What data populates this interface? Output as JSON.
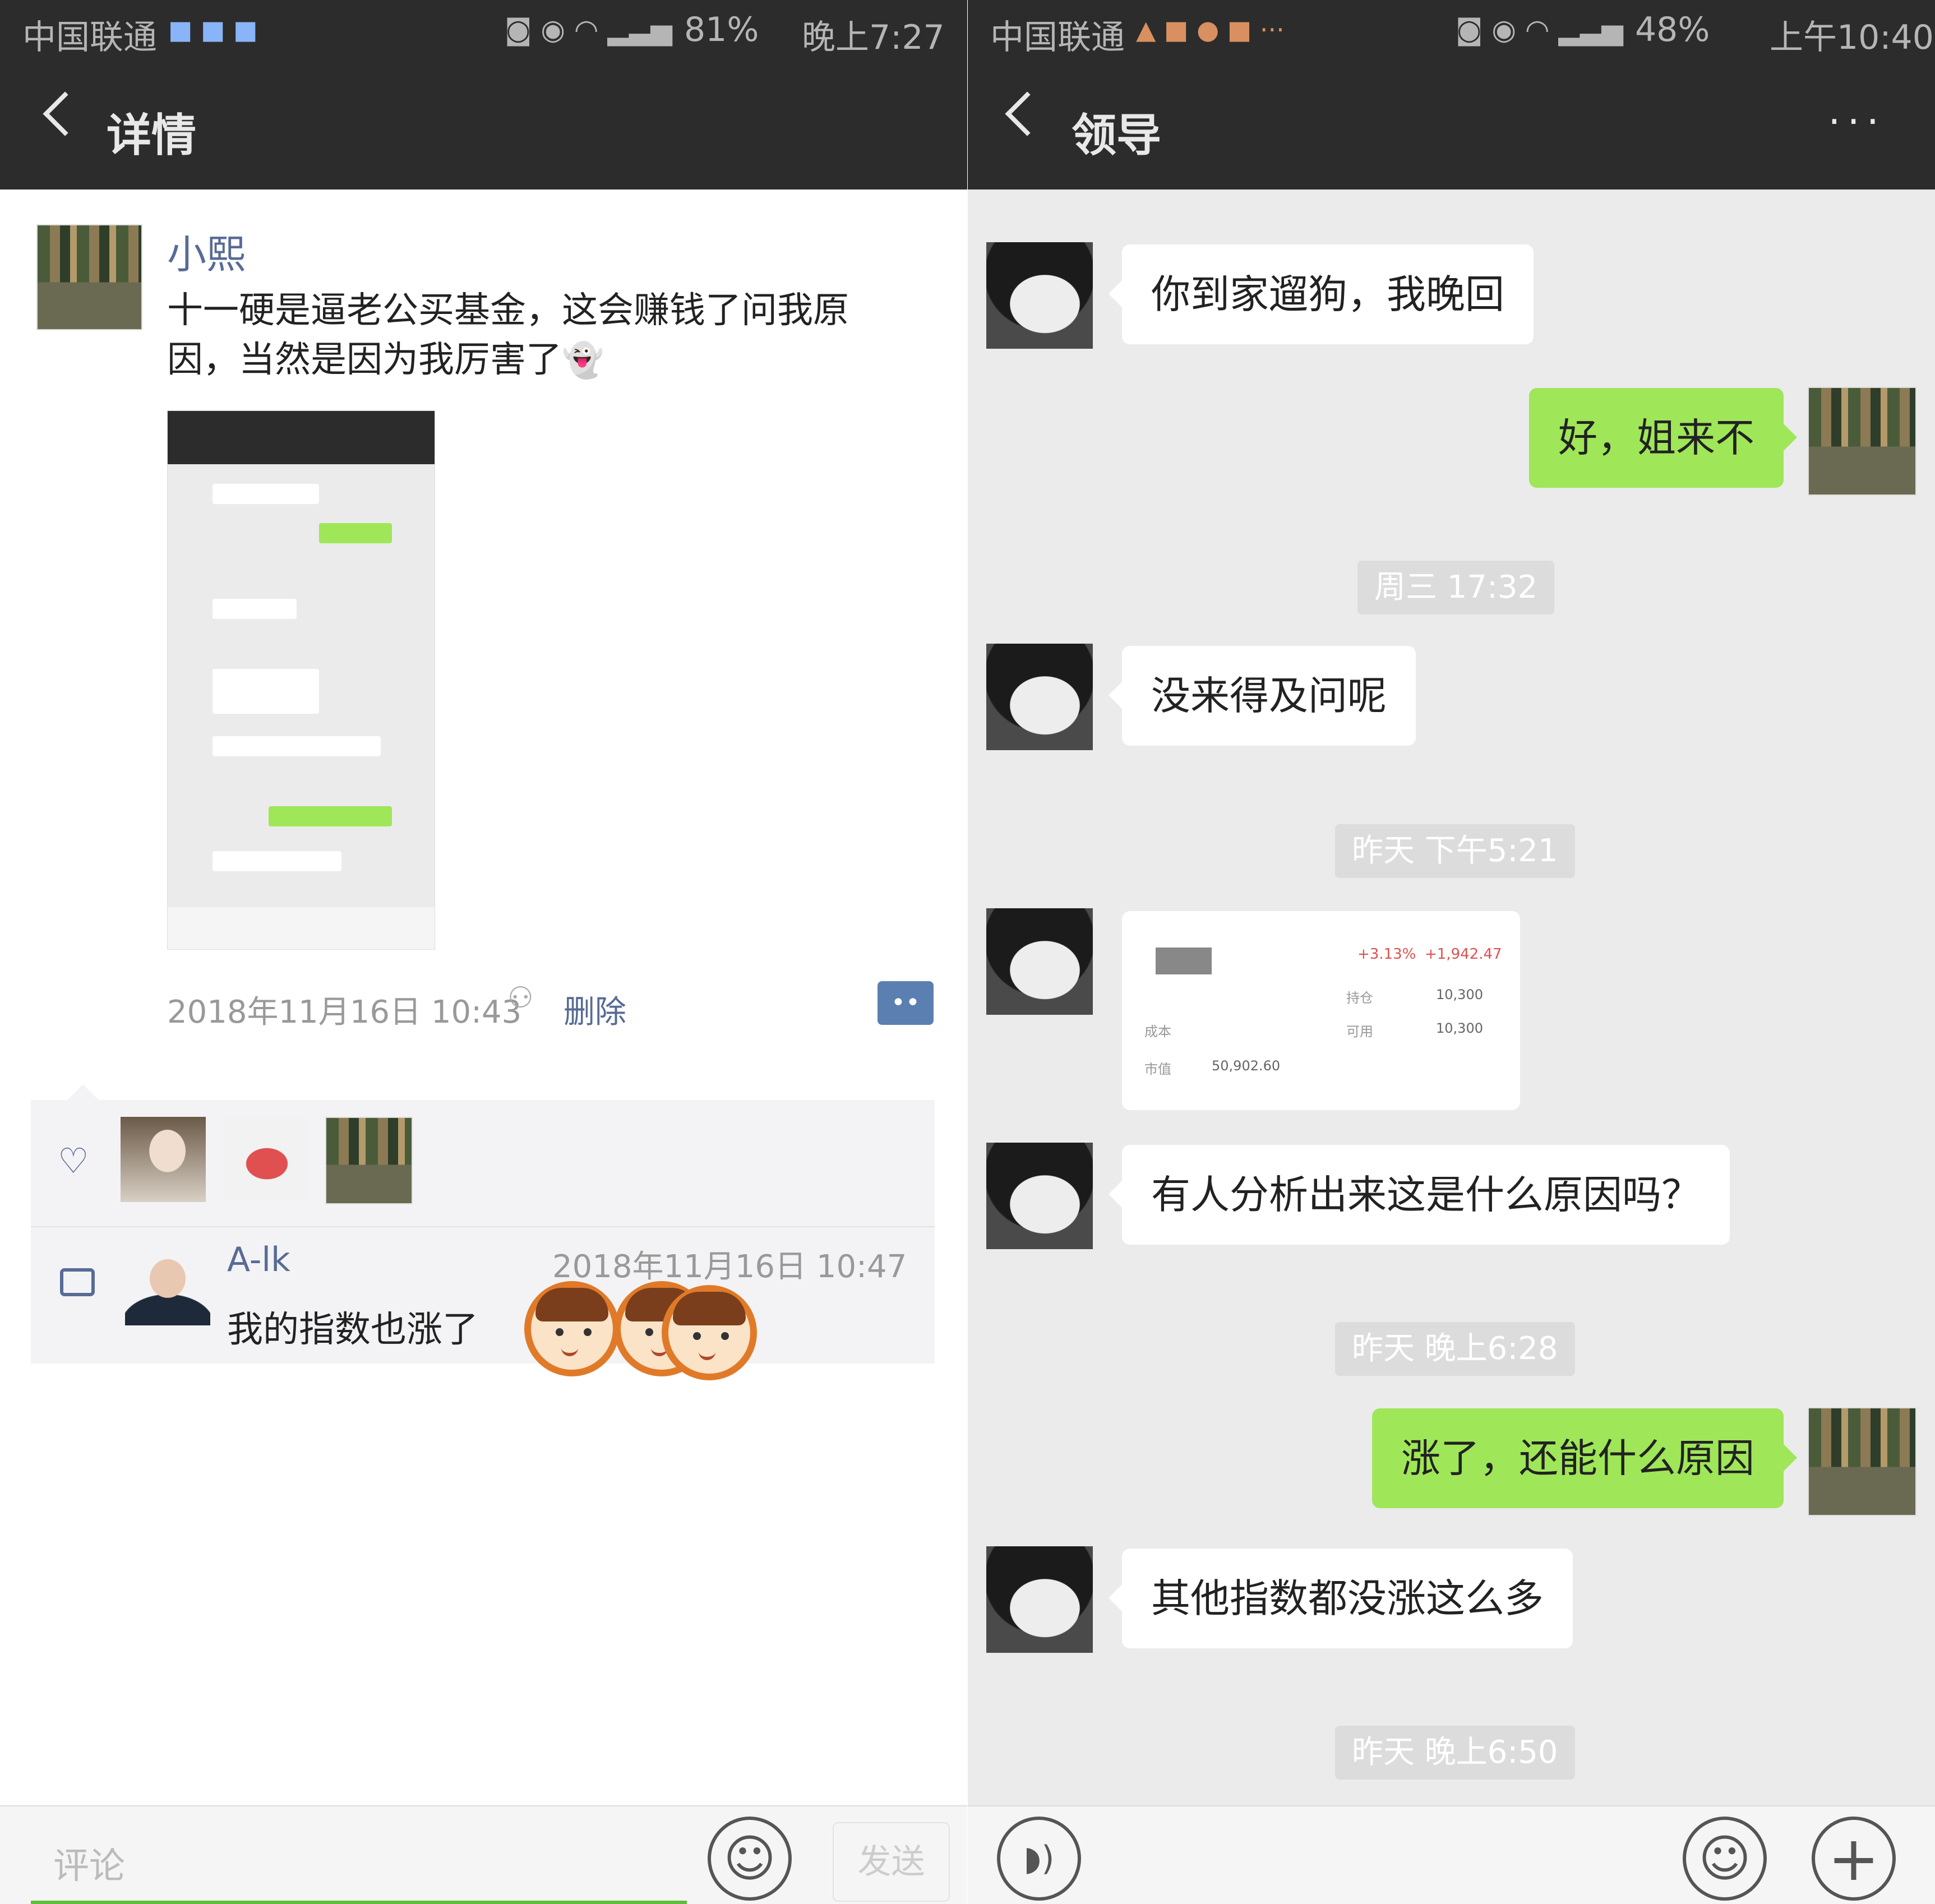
{
  "left": {
    "status": {
      "carrier": "中国联通",
      "signal": "81%",
      "time": "晚上7:27"
    },
    "nav": {
      "title": "详情"
    },
    "moment": {
      "author": "小熙",
      "text": "十一硬是逼老公买基金，这会赚钱了问我原因，当然是因为我厉害了",
      "timestamp": "2018年11月16日 10:43",
      "delete_label": "删除"
    },
    "comment": {
      "author": "A-lk",
      "time": "2018年11月16日 10:47",
      "text": "我的指数也涨了"
    },
    "input": {
      "placeholder": "评论",
      "send_label": "发送"
    }
  },
  "right": {
    "status": {
      "carrier": "中国联通",
      "signal": "48%",
      "time": "上午10:40"
    },
    "nav": {
      "title": "领导",
      "more": "···"
    },
    "messages": [
      {
        "from": "them",
        "text": "你到家遛狗，我晚回"
      },
      {
        "from": "me",
        "text": "好，姐来不"
      },
      {
        "timestamp": "周三 17:32"
      },
      {
        "from": "them",
        "text": "没来得及问呢"
      },
      {
        "timestamp": "昨天 下午5:21"
      },
      {
        "from": "them",
        "type": "image",
        "card": {
          "pct": "+3.13%",
          "amount": "+1,942.47",
          "v1": "10,300",
          "v2": "10,300",
          "total": "50,902.60",
          "l1": "持仓",
          "l2": "可用",
          "l3": "成本",
          "l4": "市值"
        }
      },
      {
        "from": "them",
        "text": "有人分析出来这是什么原因吗？"
      },
      {
        "timestamp": "昨天 晚上6:28"
      },
      {
        "from": "me",
        "text": "涨了，还能什么原因"
      },
      {
        "from": "them",
        "text": "其他指数都没涨这么多"
      },
      {
        "timestamp": "昨天 晚上6:50"
      }
    ]
  },
  "colors": {
    "nav_bg": "#2c2c2c",
    "chat_bg": "#ebebeb",
    "me_bubble": "#9fe658",
    "link": "#576b95",
    "emoji_ring": "#e07a28"
  },
  "icons": [
    "back-icon",
    "more-icon",
    "heart-icon",
    "comment-icon",
    "emoji-icon",
    "voice-icon",
    "plus-icon",
    "group-visibility-icon",
    "action-menu-icon"
  ]
}
